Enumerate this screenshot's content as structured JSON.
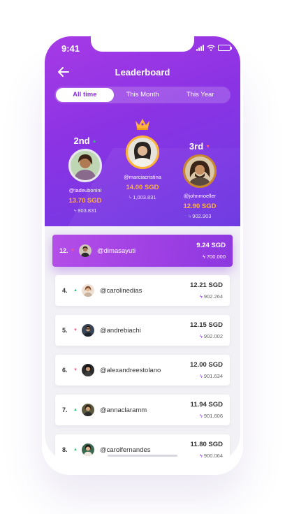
{
  "status": {
    "time": "9:41"
  },
  "header": {
    "title": "Leaderboard"
  },
  "tabs": [
    {
      "label": "All time",
      "active": true
    },
    {
      "label": "This Month",
      "active": false
    },
    {
      "label": "This Year",
      "active": false
    }
  ],
  "podium": {
    "first": {
      "rank": "",
      "username": "@marciacristina",
      "sgd": "14.00 SGD",
      "points": "1,003.831",
      "icon": "crown-icon"
    },
    "second": {
      "rank": "2nd",
      "trend": "up",
      "username": "@tadeubonini",
      "sgd": "13.70 SGD",
      "points": "903.831"
    },
    "third": {
      "rank": "3rd",
      "trend": "down",
      "username": "@johnmoeller",
      "sgd": "12.90 SGD",
      "points": "902.903"
    }
  },
  "current_user": {
    "rank": "12.",
    "trend": "down",
    "username": "@dimasayuti",
    "sgd": "9.24 SGD",
    "points": "700.000"
  },
  "rows": [
    {
      "rank": "4.",
      "trend": "up",
      "username": "@carolinedias",
      "sgd": "12.21 SGD",
      "points": "902.264"
    },
    {
      "rank": "5.",
      "trend": "down",
      "username": "@andrebiachi",
      "sgd": "12.15 SGD",
      "points": "902.002"
    },
    {
      "rank": "6.",
      "trend": "down",
      "username": "@alexandreestolano",
      "sgd": "12.00 SGD",
      "points": "901.634"
    },
    {
      "rank": "7.",
      "trend": "up",
      "username": "@annaclaramm",
      "sgd": "11.94 SGD",
      "points": "901.606"
    },
    {
      "rank": "8.",
      "trend": "up",
      "username": "@carolfernandes",
      "sgd": "11.80 SGD",
      "points": "900.064"
    }
  ],
  "colors": {
    "primary": "#8a33e4",
    "gold": "#ffb238",
    "up": "#2fbf71",
    "down": "#ff5a7e"
  }
}
